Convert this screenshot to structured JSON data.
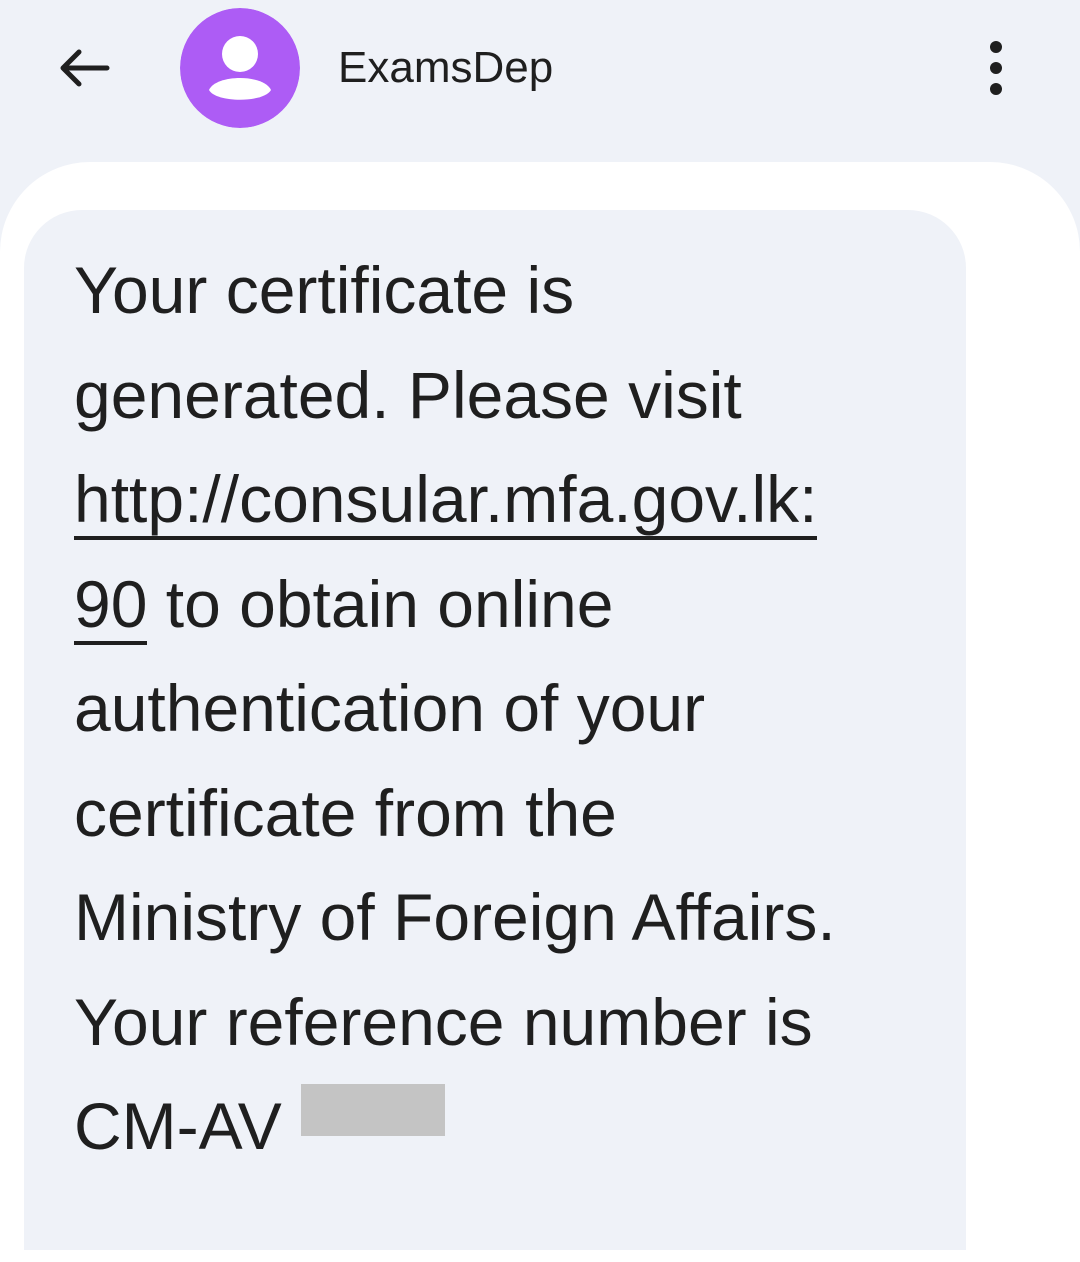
{
  "app_bar": {
    "contact_name": "ExamsDep",
    "back_icon": "arrow-left-icon",
    "avatar_icon": "person-icon",
    "more_icon": "more-vert-icon"
  },
  "message": {
    "line_1": "Your certificate is",
    "line_2_before": "generated. Please visit ",
    "link_part_1": "http://consular.mfa.gov.lk:",
    "link_part_2": "90",
    "line_4_after": " to obtain online",
    "line_5": "authentication of your",
    "line_6": "certificate from the",
    "line_7": "Ministry of Foreign Affairs.",
    "line_8": "Your reference number is",
    "line_9": "CM-AV"
  },
  "colors": {
    "background": "#eff2f8",
    "avatar": "#ad5cf5",
    "text": "#1f1f1f",
    "conversation": "#ffffff",
    "redaction": "#c4c4c4"
  }
}
